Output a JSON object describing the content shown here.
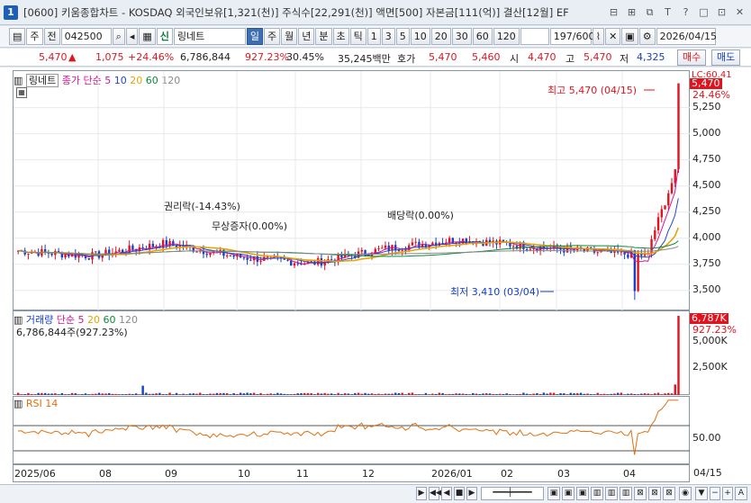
{
  "window": {
    "title": "[0600] 키움종합차트 - KOSDAQ 외국인보유[1,321(천)] 주식수[22,291(천)] 액면[500] 자본금[111(억)] 결산[12월] EF",
    "icon_label": "1",
    "buttons": [
      "⊟",
      "⊞",
      "⧉",
      "T",
      "?",
      "□",
      "⊡",
      "✕"
    ]
  },
  "toolbar": {
    "period_sel": "주",
    "period_prev": "전",
    "code": "042500",
    "stock_name": "링네트",
    "sin": "신",
    "tabs": [
      "일",
      "주",
      "월",
      "년",
      "분",
      "초",
      "틱"
    ],
    "intervals": [
      "1",
      "3",
      "5",
      "10",
      "20",
      "30",
      "60",
      "120"
    ],
    "count": "197/600",
    "date": "2026/04/15"
  },
  "quote": {
    "price": "5,470",
    "change": "1,075",
    "pct": "+24.46%",
    "volume": "6,786,844",
    "vol_ratio": "927.23%",
    "turnover": "30.45%",
    "amount": "35,245백만",
    "bid_label": "호가",
    "bid1": "5,470",
    "bid2": "5,460",
    "open_label": "시",
    "open": "4,470",
    "high_label": "고",
    "high": "5,470",
    "low_label": "저",
    "low": "4,325",
    "buy_btn": "매수",
    "sell_btn": "매도"
  },
  "price_pane": {
    "name_label": "링네트",
    "legend_label": "종가 단순",
    "ma": [
      "5",
      "10",
      "20",
      "60",
      "120"
    ],
    "high_note": "최고 5,470 (04/15)",
    "low_note": "최저 3,410 (03/04)",
    "events": [
      "권리락(-14.43%)",
      "무상증자(0.00%)",
      "배당락(0.00%)"
    ],
    "last_price": "5,470",
    "last_pct": "24.46%",
    "axis_corner": "LC:60.41",
    "yticks": [
      "5,250",
      "5,000",
      "4,750",
      "4,500",
      "4,250",
      "4,000",
      "3,750",
      "3,500"
    ]
  },
  "volume_pane": {
    "label": "거래량",
    "legend_label": "단순",
    "ma": [
      "5",
      "20",
      "60",
      "120"
    ],
    "value": "6,786,844주(927.23%)",
    "last": "6,787K",
    "last_pct": "927.23%",
    "yticks": [
      "5,000K",
      "2,500K"
    ]
  },
  "rsi_pane": {
    "label": "RSI 14",
    "yticks": [
      "50.00"
    ]
  },
  "xaxis": {
    "labels": [
      "2025/06",
      "08",
      "09",
      "10",
      "11",
      "12",
      "2026/01",
      "02",
      "03",
      "04"
    ],
    "end_label": "04/15"
  },
  "colors": {
    "up": "#e0141e",
    "down": "#1540c8",
    "ma5": "#d4148c",
    "ma10": "#2147c6",
    "ma20": "#e8a400",
    "ma60": "#0a8a3a",
    "ma120": "#8a8a8a",
    "rsi": "#e07010"
  },
  "chart_data": {
    "type": "candlestick",
    "title": "링네트 (042500)",
    "last": 5470,
    "high": {
      "value": 5470,
      "date": "04/15"
    },
    "low": {
      "value": 3410,
      "date": "03/04"
    },
    "ylim": [
      3300,
      5600
    ],
    "x": [
      "2025/06",
      "08",
      "09",
      "10",
      "11",
      "12",
      "2026/01",
      "02",
      "03",
      "04"
    ],
    "close_approx": [
      3880,
      3830,
      3950,
      3820,
      3760,
      3900,
      3990,
      3920,
      3860,
      3820,
      5470
    ],
    "series": [
      {
        "name": "거래량",
        "last": 6786844
      }
    ]
  }
}
